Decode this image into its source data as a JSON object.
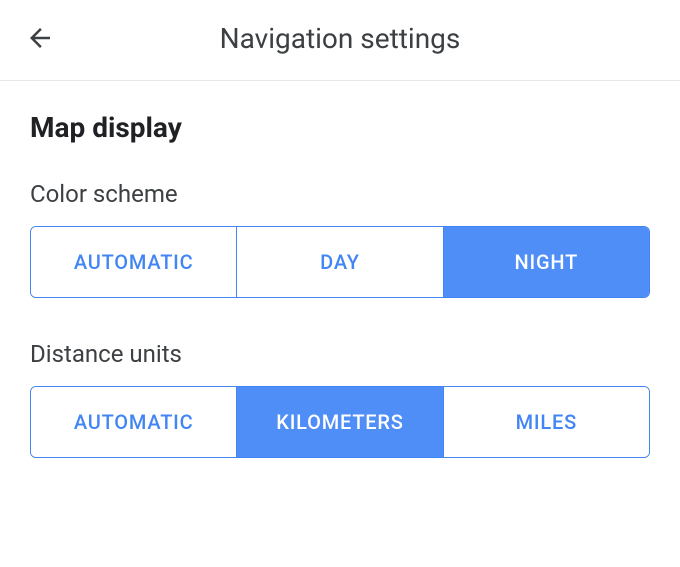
{
  "header": {
    "title": "Navigation settings"
  },
  "section": {
    "heading": "Map display"
  },
  "color_scheme": {
    "label": "Color scheme",
    "options": {
      "automatic": "AUTOMATIC",
      "day": "DAY",
      "night": "NIGHT"
    },
    "selected": "night"
  },
  "distance_units": {
    "label": "Distance units",
    "options": {
      "automatic": "AUTOMATIC",
      "kilometers": "KILOMETERS",
      "miles": "MILES"
    },
    "selected": "kilometers"
  },
  "colors": {
    "accent": "#4285f4",
    "accent_fill": "#4f8ef7"
  }
}
